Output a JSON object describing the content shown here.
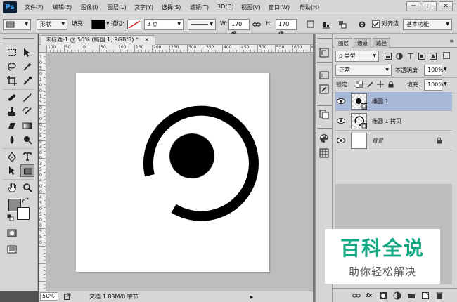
{
  "app": {
    "logo": "Ps"
  },
  "menu": [
    "文件(F)",
    "编辑(E)",
    "图像(I)",
    "图层(L)",
    "文字(Y)",
    "选择(S)",
    "滤镜(T)",
    "3D(D)",
    "视图(V)",
    "窗口(W)",
    "帮助(H)"
  ],
  "window_controls": {
    "minimize": "─",
    "restore": "□",
    "close": "✕"
  },
  "options": {
    "mode": "形状",
    "fill_label": "填充:",
    "stroke_label": "描边:",
    "stroke_width": "3 点",
    "w_label": "W:",
    "w_value": "170 像",
    "h_label": "H:",
    "h_value": "170 像",
    "align_edges": "对齐边",
    "workspace": "基本功能",
    "fill_color": "#000000"
  },
  "document": {
    "tab_title": "未标题-1 @ 50% (椭圆 1, RGB/8) *",
    "tab_close": "×",
    "ruler_h": [
      "100",
      "50",
      "0",
      "50",
      "100",
      "150",
      "200",
      "250",
      "300",
      "350",
      "400",
      "450",
      "500",
      "550",
      "600",
      "650"
    ],
    "ruler_v": [
      "1",
      "0",
      "5",
      "0",
      "1",
      "0",
      "0",
      "1",
      "5",
      "0",
      "2",
      "0",
      "0",
      "2",
      "5",
      "0",
      "3",
      "0",
      "0",
      "3",
      "5",
      "0",
      "4",
      "0",
      "0",
      "4",
      "5",
      "0",
      "5",
      "0",
      "0",
      "5",
      "5",
      "0"
    ]
  },
  "status": {
    "zoom": "50%",
    "doc_info": "文档:1.83M/0 字节"
  },
  "layers_panel": {
    "tabs": [
      "图层",
      "通道",
      "路径"
    ],
    "filter": "ρ 类型",
    "blend_mode": "正常",
    "opacity_label": "不透明度:",
    "opacity_value": "100%",
    "lock_label": "锁定:",
    "fill_label": "填充:",
    "fill_value": "100%",
    "layers": [
      {
        "name": "椭圆 1",
        "selected": true
      },
      {
        "name": "椭圆 1 拷贝",
        "selected": false
      },
      {
        "name": "背景",
        "selected": false
      }
    ],
    "footer_icons": [
      "link-icon",
      "fx-icon",
      "mask-icon",
      "adjustment-icon",
      "group-icon",
      "new-layer-icon",
      "trash-icon"
    ],
    "footer_fx": "fx"
  },
  "watermark": {
    "title": "百科全说",
    "subtitle": "助你轻松解决"
  }
}
